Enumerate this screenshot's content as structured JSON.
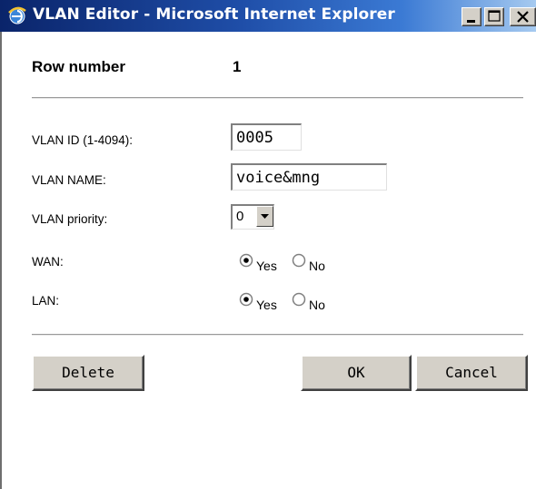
{
  "window": {
    "title": "VLAN Editor - Microsoft Internet Explorer",
    "icon": "ie-icon",
    "controls": [
      "minimize-icon",
      "maximize-icon",
      "close-icon"
    ]
  },
  "header": {
    "row_label": "Row number",
    "row_value": "1"
  },
  "form": {
    "vlan_id_label": "VLAN ID (1-4094):",
    "vlan_id_value": "0005",
    "vlan_name_label": "VLAN NAME:",
    "vlan_name_value": "voice&mng",
    "priority_label": "VLAN priority:",
    "priority_value": "0",
    "wan_label": "WAN:",
    "wan_yes": "Yes",
    "wan_no": "No",
    "wan_selected": "Yes",
    "lan_label": "LAN:",
    "lan_yes": "Yes",
    "lan_no": "No",
    "lan_selected": "Yes"
  },
  "buttons": {
    "delete": "Delete",
    "ok": "OK",
    "cancel": "Cancel"
  }
}
